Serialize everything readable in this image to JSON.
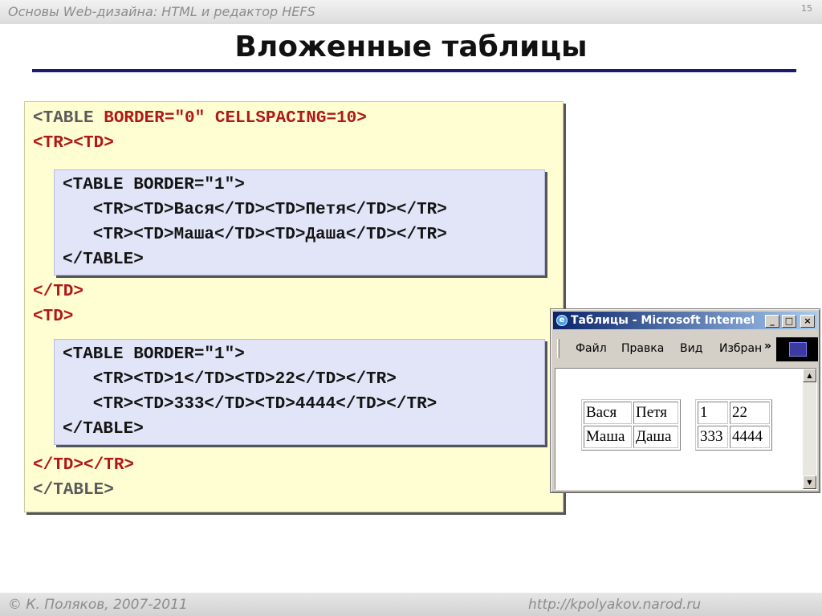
{
  "header": {
    "subtitle": "Основы Web-дизайна: HTML и редактор HEFS",
    "slide_number": "15"
  },
  "title": "Вложенные таблицы",
  "code": {
    "outer_open_tag": "<TABLE",
    "outer_open_attrs": " BORDER=\"0\" CELLSPACING=10>",
    "row_open": "<TR><TD>",
    "cell_close": "</TD>",
    "cell_open": "<TD>",
    "outer_close_cells": "</TD></TR>",
    "outer_close": "</TABLE>",
    "inner1": [
      "<TABLE BORDER=\"1\">",
      "   <TR><TD>Вася</TD><TD>Петя</TD></TR>",
      "   <TR><TD>Маша</TD><TD>Даша</TD></TR>",
      "</TABLE>"
    ],
    "inner2": [
      "<TABLE BORDER=\"1\">",
      "   <TR><TD>1</TD><TD>22</TD></TR>",
      "   <TR><TD>333</TD><TD>4444</TD></TR>",
      "</TABLE>"
    ]
  },
  "browser": {
    "title": "Таблицы - Microsoft Internet Explorer",
    "icon_label": "e",
    "buttons": {
      "minimize": "_",
      "maximize": "□",
      "close": "×"
    },
    "menu": [
      "Файл",
      "Правка",
      "Вид",
      "Избранное"
    ],
    "menu_more": "»",
    "table1": [
      [
        "Вася",
        "Петя"
      ],
      [
        "Маша",
        "Даша"
      ]
    ],
    "table2": [
      [
        "1",
        "22"
      ],
      [
        "333",
        "4444"
      ]
    ],
    "scroll_up": "▲",
    "scroll_down": "▼"
  },
  "footer": {
    "author": "© К. Поляков, 2007-2011",
    "url": "http://kpolyakov.narod.ru"
  }
}
